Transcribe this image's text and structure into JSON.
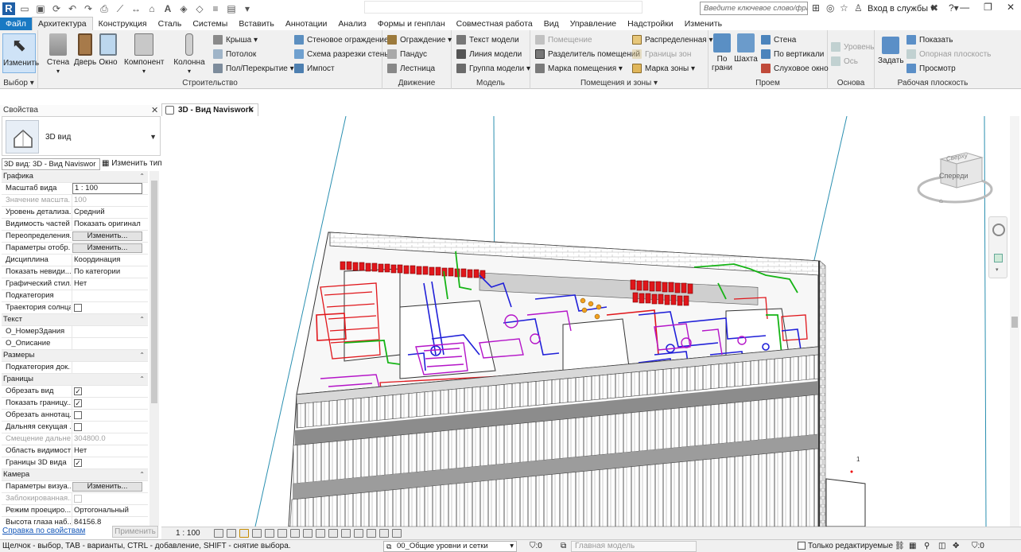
{
  "app": {
    "logo_letter": "R",
    "title": ""
  },
  "qat_icons": [
    "open-icon",
    "save-icon",
    "sync-icon",
    "undo-icon",
    "redo-icon",
    "print-icon",
    "measure-icon",
    "dimension-icon",
    "text-icon",
    "3d-view-icon",
    "section-icon",
    "thin-lines-icon",
    "close-hidden-icon",
    "switch-windows-icon"
  ],
  "search": {
    "placeholder": "Введите ключевое слово/фразу"
  },
  "signin": {
    "label": "Вход в службы"
  },
  "tabs": [
    "Файл",
    "Архитектура",
    "Конструкция",
    "Сталь",
    "Системы",
    "Вставить",
    "Аннотации",
    "Анализ",
    "Формы и генплан",
    "Совместная работа",
    "Вид",
    "Управление",
    "Надстройки",
    "Изменить"
  ],
  "active_tab": "Архитектура",
  "ribbon": {
    "select": {
      "label": "Выбор",
      "modify": "Изменить"
    },
    "build": {
      "label": "Строительство",
      "wall": "Стена",
      "door": "Дверь",
      "window": "Окно",
      "component": "Компонент",
      "column": "Колонна",
      "roof": "Крыша",
      "ceiling": "Потолок",
      "floor": "Пол/Перекрытие",
      "curtain_system": "Стеновое ограждение",
      "curtain_grid": "Схема разрезки стены",
      "mullion": "Импост"
    },
    "circulation": {
      "label": "Движение",
      "railing": "Ограждение",
      "ramp": "Пандус",
      "stair": "Лестница"
    },
    "model": {
      "label": "Модель",
      "model_text": "Текст модели",
      "model_line": "Линия модели",
      "model_group": "Группа модели"
    },
    "room": {
      "label": "Помещения и зоны",
      "room": "Помещение",
      "room_separator": "Разделитель помещений",
      "tag_room": "Марка помещения",
      "area": "Распределенная",
      "area_boundary": "Границы зон",
      "tag_area": "Марка зоны"
    },
    "opening": {
      "label": "Проем",
      "by_face": "По грани",
      "shaft": "Шахта",
      "wall": "Стена",
      "vertical": "По вертикали",
      "dormer": "Слуховое окно"
    },
    "datum": {
      "label": "Основа",
      "level": "Уровень",
      "grid": "Ось"
    },
    "workplane": {
      "label": "Рабочая плоскость",
      "set": "Задать",
      "show": "Показать",
      "ref_plane": "Опорная плоскость",
      "viewer": "Просмотр"
    }
  },
  "properties": {
    "title": "Свойства",
    "type_name": "3D вид",
    "instance_selector": "3D вид: 3D - Вид Naviswor",
    "edit_type": "Изменить тип",
    "rows": [
      {
        "kind": "group",
        "label": "Графика"
      },
      {
        "kind": "input",
        "label": "Масштаб вида",
        "value": "1 : 100"
      },
      {
        "kind": "ro",
        "label": "Значение масшта...",
        "value": "100"
      },
      {
        "kind": "text",
        "label": "Уровень детализа...",
        "value": "Средний"
      },
      {
        "kind": "text",
        "label": "Видимость частей",
        "value": "Показать оригинал"
      },
      {
        "kind": "button",
        "label": "Переопределения...",
        "value": "Изменить..."
      },
      {
        "kind": "button",
        "label": "Параметры отобр...",
        "value": "Изменить..."
      },
      {
        "kind": "text",
        "label": "Дисциплина",
        "value": "Координация"
      },
      {
        "kind": "text",
        "label": "Показать невиди...",
        "value": "По категории"
      },
      {
        "kind": "text",
        "label": "Графический стил...",
        "value": "Нет"
      },
      {
        "kind": "text",
        "label": "Подкатегория",
        "value": ""
      },
      {
        "kind": "check",
        "label": "Траектория солнца",
        "checked": false
      },
      {
        "kind": "group",
        "label": "Текст"
      },
      {
        "kind": "text",
        "label": "О_НомерЗдания",
        "value": ""
      },
      {
        "kind": "text",
        "label": "О_Описание",
        "value": ""
      },
      {
        "kind": "group",
        "label": "Размеры"
      },
      {
        "kind": "text",
        "label": "Подкатегория док...",
        "value": ""
      },
      {
        "kind": "group",
        "label": "Границы"
      },
      {
        "kind": "check",
        "label": "Обрезать вид",
        "checked": true
      },
      {
        "kind": "check",
        "label": "Показать границу...",
        "checked": true
      },
      {
        "kind": "check",
        "label": "Обрезать аннотац...",
        "checked": false
      },
      {
        "kind": "check",
        "label": "Дальняя секущая ...",
        "checked": false
      },
      {
        "kind": "ro",
        "label": "Смещение дальне...",
        "value": "304800.0"
      },
      {
        "kind": "text",
        "label": "Область видимости",
        "value": "Нет"
      },
      {
        "kind": "check",
        "label": "Границы 3D вида",
        "checked": true
      },
      {
        "kind": "group",
        "label": "Камера"
      },
      {
        "kind": "button",
        "label": "Параметры визуа...",
        "value": "Изменить..."
      },
      {
        "kind": "rocheck",
        "label": "Заблокированная...",
        "checked": false
      },
      {
        "kind": "text",
        "label": "Режим проециро...",
        "value": "Ортогональный"
      },
      {
        "kind": "text",
        "label": "Высота глаза наб...",
        "value": "84156.8"
      }
    ],
    "help_link": "Справка по свойствам",
    "apply": "Применить"
  },
  "view": {
    "tab_title": "3D - Вид Naviswork",
    "scale": "1 : 100",
    "viewcube_top": "Сверху",
    "viewcube_front": "Спереди",
    "marker": "1"
  },
  "status": {
    "message": "Щелчок - выбор, TAB - варианты, CTRL - добавление, SHIFT - снятие выбора.",
    "workset": "00_Общие уровни и сетки",
    "zero": ":0",
    "main_model": "Главная модель",
    "editable_only": "Только редактируемые"
  },
  "colors": {
    "accent": "#1979c3",
    "mep_red": "#e0161b",
    "mep_blue": "#2020d8",
    "mep_green": "#16b416",
    "mep_magenta": "#b414c8",
    "grid_line": "#2a8fb0"
  }
}
